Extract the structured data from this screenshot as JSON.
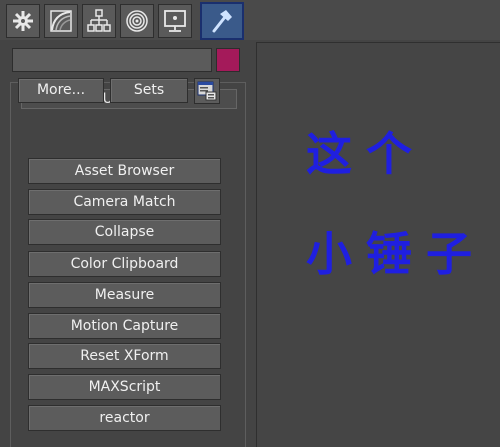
{
  "tabs": [
    {
      "icon": "create-gear-icon"
    },
    {
      "icon": "modify-bend-icon"
    },
    {
      "icon": "hierarchy-icon"
    },
    {
      "icon": "motion-icon"
    },
    {
      "icon": "display-monitor-icon"
    },
    {
      "icon": "utilities-hammer-icon",
      "active": true
    }
  ],
  "colors": {
    "accent": "#1f1fe0",
    "active_tab": "#3a5a8a",
    "swatch": "#a41a5a"
  },
  "rollout": {
    "toggle": "-",
    "title": "Utilities"
  },
  "buttons": {
    "more": "More...",
    "sets": "Sets"
  },
  "utilities": [
    "Asset Browser",
    "Camera Match",
    "Collapse",
    "Color Clipboard",
    "Measure",
    "Motion Capture",
    "Reset XForm",
    "MAXScript",
    "reactor"
  ],
  "annotation": {
    "line1": "这个",
    "line2": "小锤子"
  }
}
